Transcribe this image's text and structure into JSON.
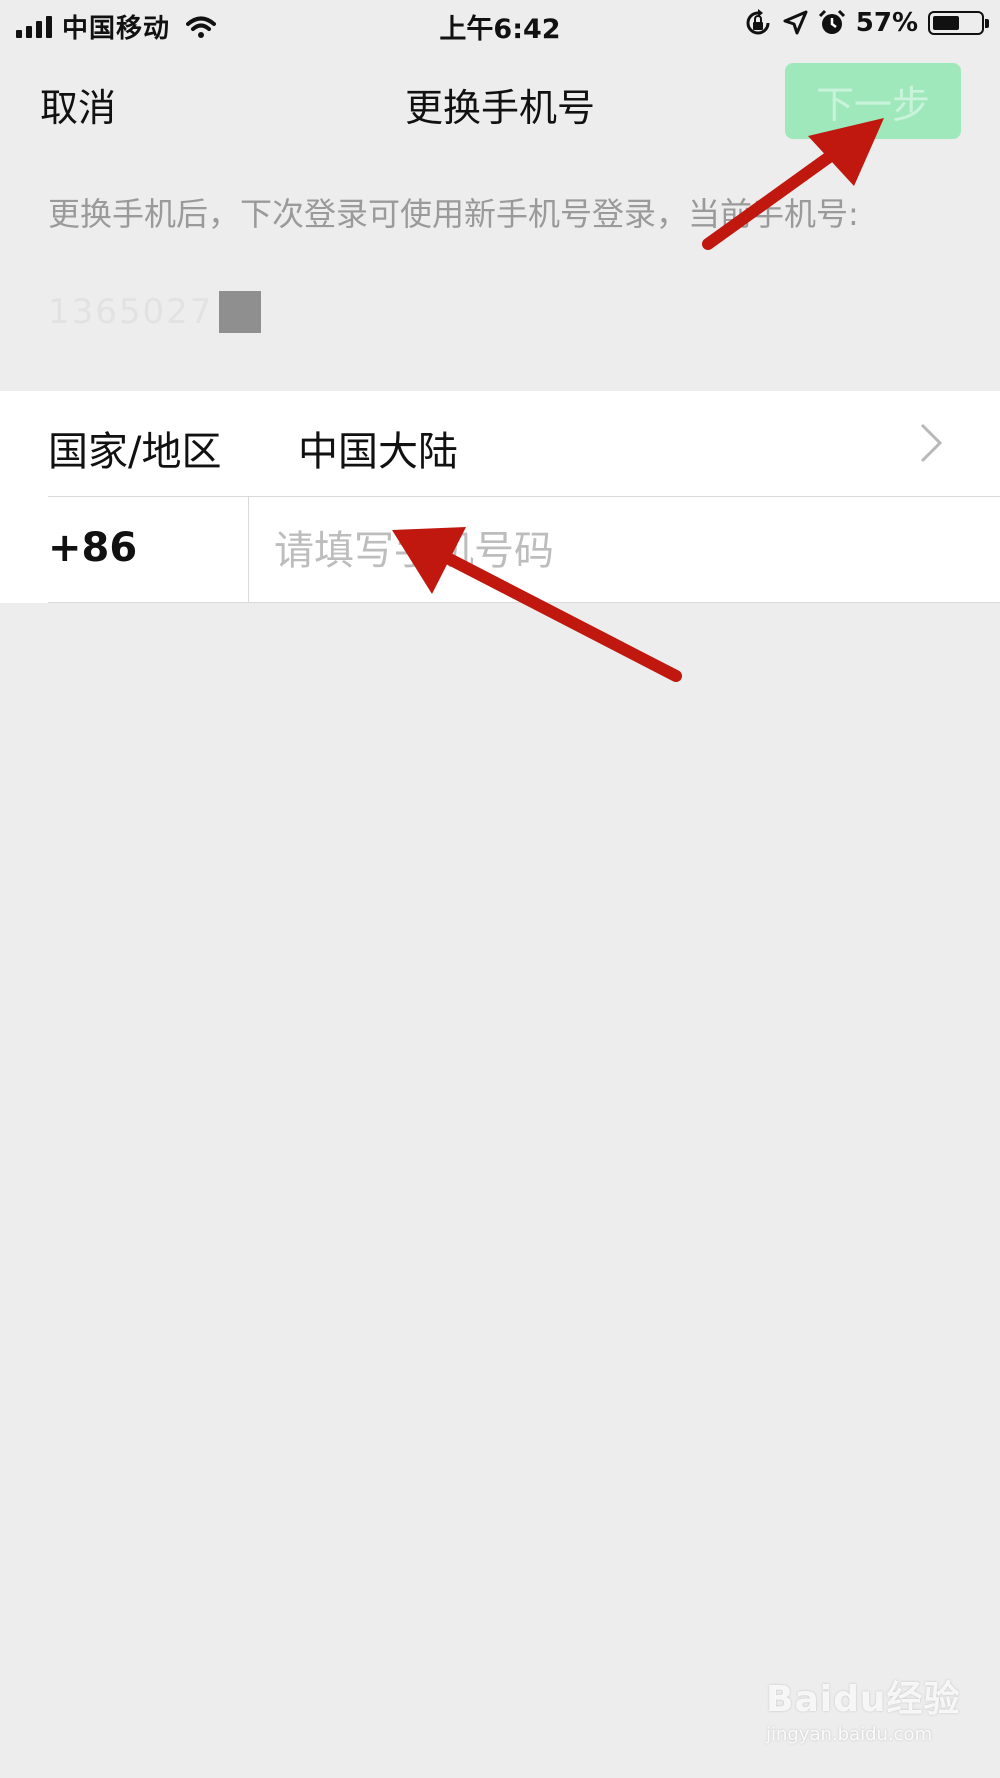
{
  "status_bar": {
    "carrier": "中国移动",
    "time": "上午6:42",
    "battery_percent": "57%",
    "battery_level": 0.57,
    "icons": [
      "signal-icon",
      "wifi-icon",
      "rotation-lock-icon",
      "location-icon",
      "alarm-icon",
      "battery-icon"
    ]
  },
  "nav": {
    "cancel_label": "取消",
    "title": "更换手机号",
    "next_label": "下一步"
  },
  "hint": {
    "text": "更换手机后，下次登录可使用新手机号登录，当前手机号:",
    "current_number": "1365027"
  },
  "form": {
    "region_label": "国家/地区",
    "region_value": "中国大陆",
    "country_code": "+86",
    "phone_placeholder": "请填写手机号码",
    "phone_value": ""
  },
  "watermark": {
    "main": "Baidu经验",
    "sub": "jingyan.baidu.com"
  },
  "colors": {
    "background": "#ededed",
    "next_button_disabled": "#9fe8bc",
    "annotation_arrow": "#c0170f"
  }
}
